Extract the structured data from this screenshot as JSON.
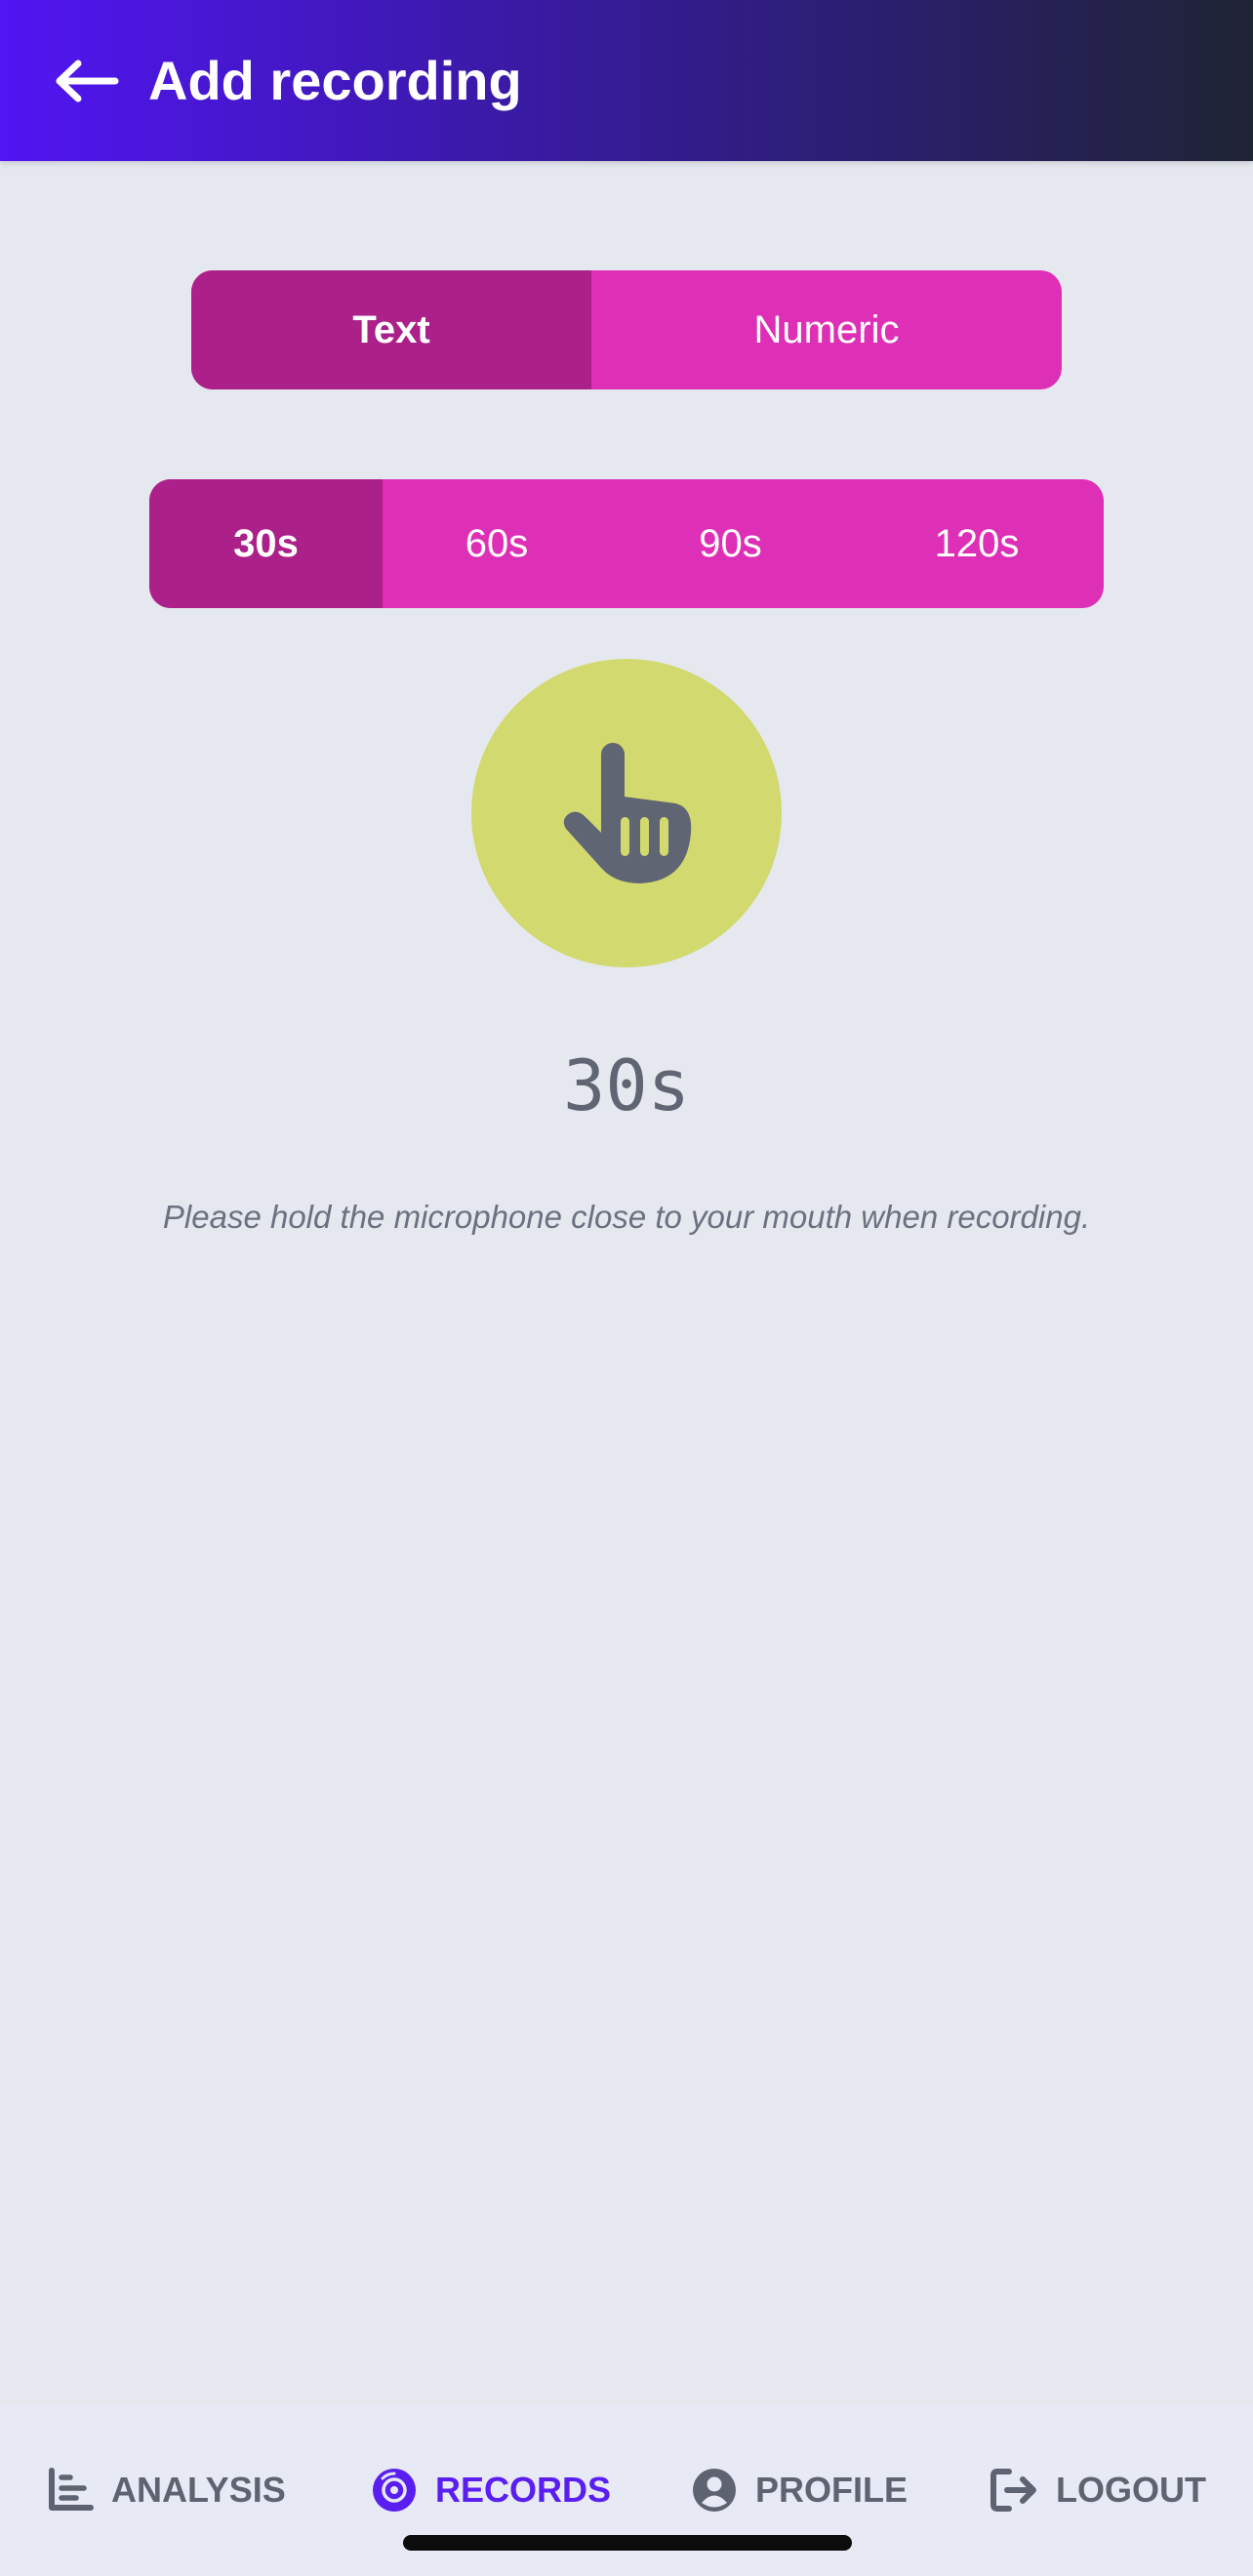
{
  "header": {
    "title": "Add recording",
    "back_icon": "arrow-left-icon"
  },
  "mode_selector": {
    "options": [
      "Text",
      "Numeric"
    ],
    "selected": "Text"
  },
  "duration_selector": {
    "options": [
      "30s",
      "60s",
      "90s",
      "120s"
    ],
    "selected": "30s"
  },
  "recorder": {
    "button_icon": "pointing-hand-icon",
    "timer": "30s",
    "hint": "Please hold the microphone close to your mouth when recording."
  },
  "bottom_nav": {
    "items": [
      {
        "label": "ANALYSIS",
        "icon": "bar-chart-icon"
      },
      {
        "label": "RECORDS",
        "icon": "vinyl-record-icon"
      },
      {
        "label": "PROFILE",
        "icon": "user-circle-icon"
      },
      {
        "label": "LOGOUT",
        "icon": "logout-icon"
      }
    ],
    "active": "RECORDS"
  },
  "colors": {
    "header_start": "#5215f3",
    "header_end": "#1f2434",
    "segment": "#de2fb7",
    "segment_active": "#ab2189",
    "record_button": "#d2d96e",
    "nav_active": "#5a1ef0",
    "background": "#e5e8ef"
  }
}
